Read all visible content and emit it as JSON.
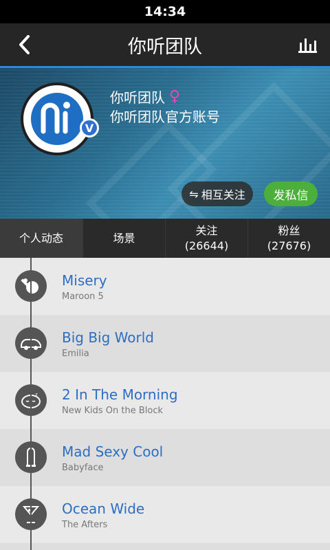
{
  "status": {
    "time": "14:34"
  },
  "topbar": {
    "title": "你听团队"
  },
  "profile": {
    "name": "你听团队",
    "gender_symbol": "♀",
    "description": "你听团队官方账号",
    "verified_badge": "V",
    "buttons": {
      "mutual_icon": "⇋",
      "mutual": "相互关注",
      "message": "发私信"
    }
  },
  "tabs": [
    {
      "label": "个人动态",
      "count": ""
    },
    {
      "label": "场景",
      "count": ""
    },
    {
      "label": "关注",
      "count": "(26644)"
    },
    {
      "label": "粉丝",
      "count": "(27676)"
    }
  ],
  "feed": [
    {
      "song": "Misery",
      "artist": "Maroon 5",
      "icon": "ping-pong-icon"
    },
    {
      "song": "Big Big World",
      "artist": "Emilia",
      "icon": "car-icon"
    },
    {
      "song": "2 In The Morning",
      "artist": "New Kids On the Block",
      "icon": "sleeping-face-icon"
    },
    {
      "song": "Mad Sexy Cool",
      "artist": "Babyface",
      "icon": "condom-icon"
    },
    {
      "song": "Ocean Wide",
      "artist": "The Afters",
      "icon": "cocktail-icon"
    }
  ],
  "colors": {
    "accent_blue": "#2b6ec2",
    "green": "#4caf3b",
    "dark": "#262626"
  }
}
